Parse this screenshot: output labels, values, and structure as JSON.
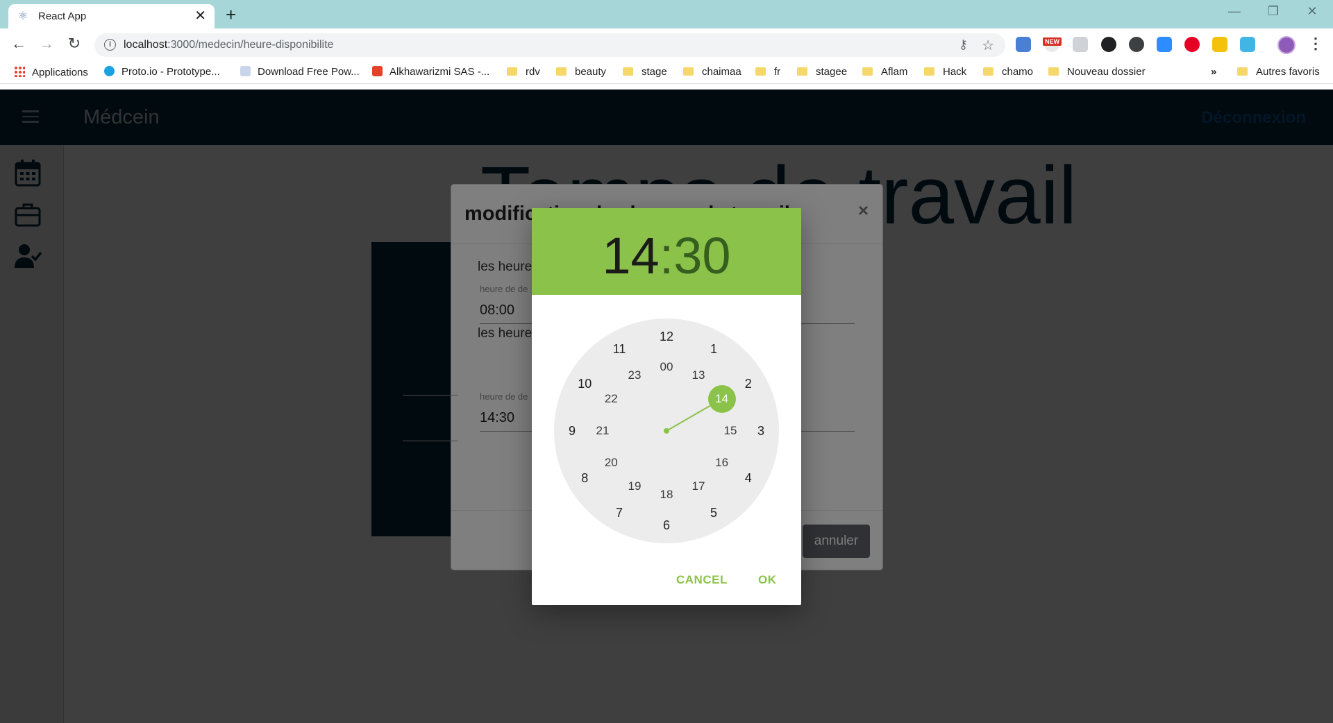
{
  "browser": {
    "tab_title": "React App",
    "tab_close": "✕",
    "new_tab": "+",
    "window_controls": {
      "minimize": "—",
      "restore": "❐",
      "close": "✕"
    },
    "url_host": "localhost",
    "url_path": ":3000/medecin/heure-disponibilite",
    "ext_badge": "NEW",
    "bookmarks": [
      "Applications",
      "Proto.io - Prototype...",
      "Download Free Pow...",
      "Alkhawarizmi SAS -...",
      "rdv",
      "beauty",
      "stage",
      "chaimaa",
      "fr",
      "stagee",
      "Aflam",
      "Hack",
      "chamo",
      "Nouveau dossier"
    ],
    "bookmarks_more": "»",
    "other_bookmarks": "Autres favoris"
  },
  "app": {
    "title": "Médcein",
    "logout": "Déconnexion",
    "page_heading": "Temps de travail"
  },
  "modal": {
    "title": "modification des heures de travail",
    "close": "×",
    "label_1": "les heure",
    "field_1_label": "heure de de",
    "field_1_value": "08:00",
    "label_2": "les heure",
    "field_2_label": "heure de de",
    "field_2_value": "14:30",
    "cancel": "annuler"
  },
  "time_picker": {
    "hours": "14",
    "separator": ":",
    "minutes": "30",
    "selected_hour": "14",
    "outer_ring": [
      "12",
      "1",
      "2",
      "3",
      "4",
      "5",
      "6",
      "7",
      "8",
      "9",
      "10",
      "11"
    ],
    "inner_ring": [
      "00",
      "13",
      "14",
      "15",
      "16",
      "17",
      "18",
      "19",
      "20",
      "21",
      "22",
      "23"
    ],
    "cancel": "CANCEL",
    "ok": "OK",
    "accent_color": "#8bc34a"
  }
}
